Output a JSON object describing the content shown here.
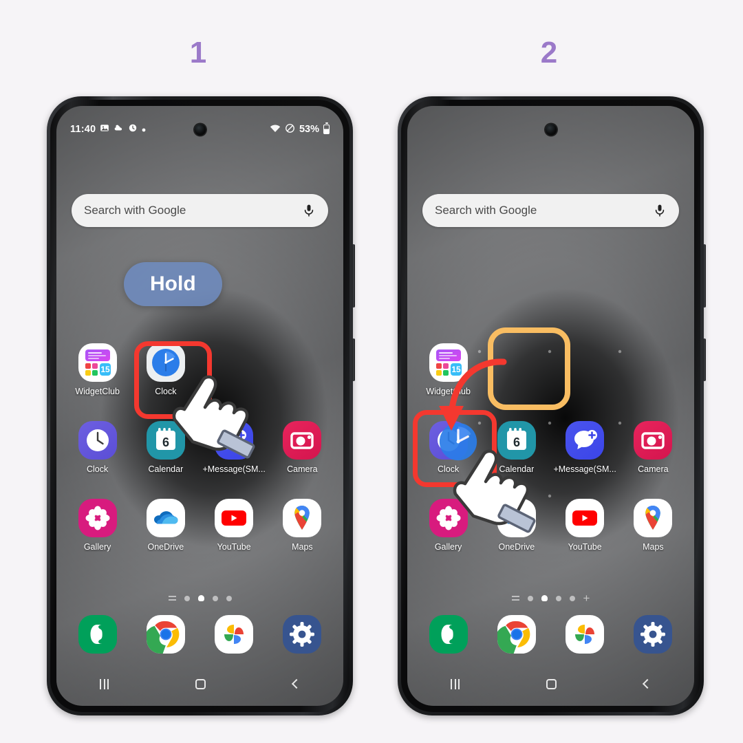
{
  "background_color": "#f6f4f7",
  "accent_colors": {
    "step_number": "#9b79c9",
    "highlight_red": "#f4382f",
    "target_orange": "#f9bd62",
    "hold_badge": "#6e8cc3"
  },
  "steps": [
    {
      "number": "1",
      "annotation": "Hold"
    },
    {
      "number": "2",
      "annotation": ""
    }
  ],
  "phone": {
    "status_bar": {
      "time": "11:40",
      "left_icons": [
        "image-icon",
        "weather-icon",
        "alarm-icon",
        "dot-icon"
      ],
      "right_icons": [
        "wifi-icon",
        "do-not-disturb-icon"
      ],
      "battery_percent": "53%"
    },
    "search": {
      "placeholder": "Search with Google",
      "mic_icon": "microphone-icon"
    },
    "page_indicator": {
      "dots": 4,
      "active_index": 1,
      "has_menu": true,
      "has_add": false,
      "add_label": "+"
    },
    "home_rows": [
      [
        {
          "label": "WidgetClub",
          "icon": "widgetclub-icon",
          "badge": "15"
        },
        {
          "label": "Clock",
          "icon": "google-clock-icon"
        },
        {
          "label": "",
          "icon": "empty-slot"
        },
        {
          "label": "",
          "icon": "empty-slot"
        }
      ],
      [
        {
          "label": "Clock",
          "icon": "samsung-clock-icon"
        },
        {
          "label": "Calendar",
          "icon": "calendar-icon",
          "badge": "6"
        },
        {
          "label": "+Message(SM...",
          "icon": "plus-message-icon"
        },
        {
          "label": "Camera",
          "icon": "camera-icon"
        }
      ],
      [
        {
          "label": "Gallery",
          "icon": "gallery-icon"
        },
        {
          "label": "OneDrive",
          "icon": "onedrive-icon"
        },
        {
          "label": "YouTube",
          "icon": "youtube-icon"
        },
        {
          "label": "Maps",
          "icon": "google-maps-icon"
        }
      ]
    ],
    "dock": [
      {
        "label": "Phone",
        "icon": "phone-icon"
      },
      {
        "label": "Chrome",
        "icon": "chrome-icon"
      },
      {
        "label": "Photos",
        "icon": "google-photos-icon"
      },
      {
        "label": "Settings",
        "icon": "settings-gear-icon"
      }
    ],
    "nav_bar": [
      {
        "label": "Recents",
        "icon": "recents-icon"
      },
      {
        "label": "Home",
        "icon": "home-icon"
      },
      {
        "label": "Back",
        "icon": "back-icon"
      }
    ]
  },
  "panel2": {
    "page_indicator_has_add": true,
    "dragged_app": "Clock",
    "target_slot_row": 1,
    "target_slot_col": 2
  }
}
